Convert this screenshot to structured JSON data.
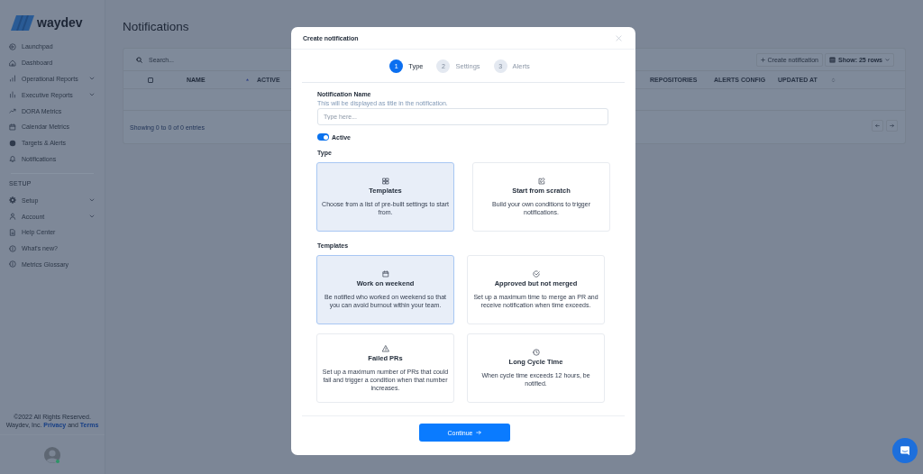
{
  "sidebar": {
    "logo": "waydev",
    "nav_items": [
      {
        "label": "Launchpad",
        "kind": "link",
        "selected": false
      },
      {
        "label": "Dashboard",
        "kind": "link",
        "selected": false
      },
      {
        "label": "Operational Reports",
        "kind": "group",
        "selected": false
      },
      {
        "label": "Executive Reports",
        "kind": "group",
        "selected": false
      },
      {
        "label": "DORA Metrics",
        "kind": "link",
        "selected": false
      },
      {
        "label": "Calendar Metrics",
        "kind": "link",
        "selected": false
      },
      {
        "label": "Targets & Alerts",
        "kind": "link",
        "selected": false
      },
      {
        "label": "Notifications",
        "kind": "link",
        "selected": false
      }
    ],
    "section_label": "SETUP",
    "setup_items": [
      {
        "label": "Setup",
        "kind": "group",
        "selected": false
      },
      {
        "label": "Account",
        "kind": "group",
        "selected": false
      },
      {
        "label": "Help Center",
        "kind": "link",
        "selected": false
      },
      {
        "label": "What's new?",
        "kind": "link",
        "selected": false
      },
      {
        "label": "Metrics Glossary",
        "kind": "link",
        "selected": false
      }
    ],
    "footer": {
      "copyright": "©2022 All Rights Reserved.",
      "company": "Waydev, Inc.",
      "privacy_link": "Privacy",
      "joiner": "and",
      "terms_link": "Terms"
    },
    "user": {
      "online": true
    }
  },
  "page": {
    "title": "Notifications",
    "table": {
      "search_placeholder": "Search...",
      "create_button": "Create notification",
      "rows_select": "Show: 25 rows",
      "select_all_checked": false,
      "columns": [
        {
          "label": "NAME",
          "sorted": true
        },
        {
          "label": "ACTIVE",
          "sorted": false
        },
        {
          "label": "REPOSITORIES",
          "sorted": false
        },
        {
          "label": "ALERTS CONFIG",
          "sorted": false
        },
        {
          "label": "UPDATED AT",
          "sorted": false
        }
      ],
      "summary": "Showing 0 to 0 of 0 entries"
    }
  },
  "modal": {
    "title": "Create notification",
    "steps": [
      {
        "number": "1",
        "label": "Type",
        "selected": true
      },
      {
        "number": "2",
        "label": "Settings",
        "selected": false
      },
      {
        "number": "3",
        "label": "Alerts",
        "selected": false
      }
    ],
    "name_field": {
      "label": "Notification Name",
      "hint": "This will be displayed as title in the notification.",
      "placeholder": "Type here..."
    },
    "active_toggle": {
      "label": "Active",
      "on": true
    },
    "type_section": {
      "label": "Type",
      "options": [
        {
          "title": "Templates",
          "description": "Choose from a list of pre-built settings to start from.",
          "selected": true
        },
        {
          "title": "Start from scratch",
          "description": "Build your own conditions to trigger notifications.",
          "selected": false
        }
      ]
    },
    "templates_section": {
      "label": "Templates",
      "options": [
        {
          "title": "Work on weekend",
          "description": "Be notified who worked on weekend so that you can avoid burnout within your team.",
          "selected": true
        },
        {
          "title": "Approved but not merged",
          "description": "Set up a maximum time to merge an PR and receive notification when time exceeds.",
          "selected": false
        },
        {
          "title": "Failed PRs",
          "description": "Set up a maximum number of PRs that could fail and trigger a condition when that number increases.",
          "selected": false
        },
        {
          "title": "Long Cycle Time",
          "description": "When cycle time exceeds 12 hours, be notified.",
          "selected": false
        }
      ]
    },
    "continue_button": "Continue"
  }
}
